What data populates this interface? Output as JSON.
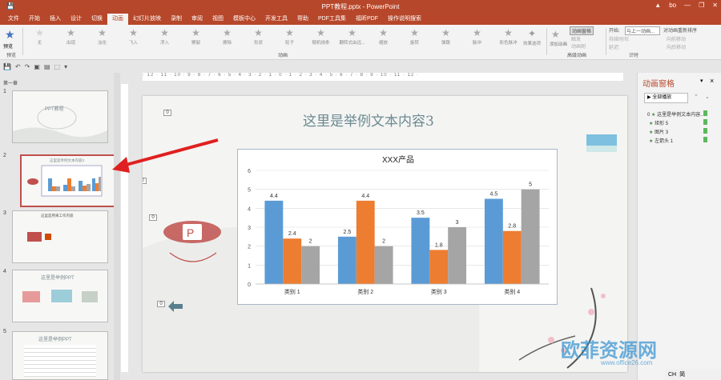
{
  "window": {
    "title": "PPT教程.pptx - PowerPoint",
    "user": "bo",
    "warning": "▲",
    "minimize": "—",
    "restore": "❐",
    "close": "✕"
  },
  "qat": {
    "save": "💾",
    "undo": "↶",
    "redo": "↷"
  },
  "menu": [
    "文件",
    "开始",
    "插入",
    "设计",
    "切换",
    "动画",
    "幻灯片放映",
    "录制",
    "审阅",
    "视图",
    "模板中心",
    "开发工具",
    "帮助",
    "PDF工具集",
    "福昕PDF",
    "操作说明搜索"
  ],
  "menu_active": "动画",
  "ribbon": {
    "preview": "预览",
    "preview_group": "预览",
    "animations": [
      "无",
      "出现",
      "淡化",
      "飞入",
      "浮入",
      "劈裂",
      "擦除",
      "形状",
      "轮子",
      "随机线条",
      "翻转式由远...",
      "缩放",
      "旋转",
      "弹跳",
      "脉冲",
      "彩色脉冲"
    ],
    "animation_group": "动画",
    "effect_options": "效果选项",
    "add_animation": "添加动画",
    "animation_pane": "动画窗格",
    "trigger": "触发",
    "animation_painter": "动画刷",
    "advanced_group": "高级动画",
    "start_label": "开始:",
    "start_value": "与上一动画...",
    "duration_label": "持续时间:",
    "delay_label": "延迟:",
    "timing_group": "计时",
    "reorder_title": "对动画重新排序",
    "move_earlier": "向前移动",
    "move_later": "向后移动"
  },
  "sidebar": {
    "section": "第一章",
    "slides": [
      {
        "num": "1",
        "title": "PPT教程"
      },
      {
        "num": "2",
        "title": "这里是举例文本内容3"
      },
      {
        "num": "3",
        "title": "这里是用来工作内容"
      },
      {
        "num": "4",
        "title": "这里是举例PPT"
      },
      {
        "num": "5",
        "title": "这里是举例PPT"
      }
    ]
  },
  "ruler": "· 12 · 11 · 10 · 9 · 8 · 7 · 6 · 5 · 4 · 3 · 2 · 1 · 0 · 1 · 2 · 3 · 4 · 5 · 6 · 7 · 8 · 9 · 10 · 11 · 12 ·",
  "slide": {
    "title": "这里是举例文本内容3",
    "tags": [
      "0",
      "0",
      "0",
      "0"
    ]
  },
  "chart_data": {
    "type": "bar",
    "title": "XXX产品",
    "categories": [
      "类别 1",
      "类别 2",
      "类别 3",
      "类别 4"
    ],
    "series": [
      {
        "color": "#5b9bd5",
        "values": [
          4.4,
          2.5,
          3.5,
          4.5
        ]
      },
      {
        "color": "#ed7d31",
        "values": [
          2.4,
          4.4,
          1.8,
          2.8
        ]
      },
      {
        "color": "#a5a5a5",
        "values": [
          2,
          2,
          3,
          5
        ]
      }
    ],
    "ylim": [
      0,
      6
    ],
    "yticks": [
      "0",
      "1",
      "2",
      "3",
      "4",
      "5",
      "6"
    ],
    "grid": true
  },
  "anim_pane": {
    "title": "动画窗格",
    "play_all": "▶ 全部播放",
    "items": [
      {
        "num": "0",
        "label": "这里是举例文本内容..."
      },
      {
        "num": "",
        "label": "矩形 5"
      },
      {
        "num": "",
        "label": "图片 3"
      },
      {
        "num": "",
        "label": "左箭头 1"
      }
    ],
    "close": "×",
    "menu": "▾"
  },
  "status": {
    "lang": "CH",
    "ime": "简"
  },
  "watermark": {
    "text": "欧菲资源网",
    "site": "www.office26.com"
  }
}
